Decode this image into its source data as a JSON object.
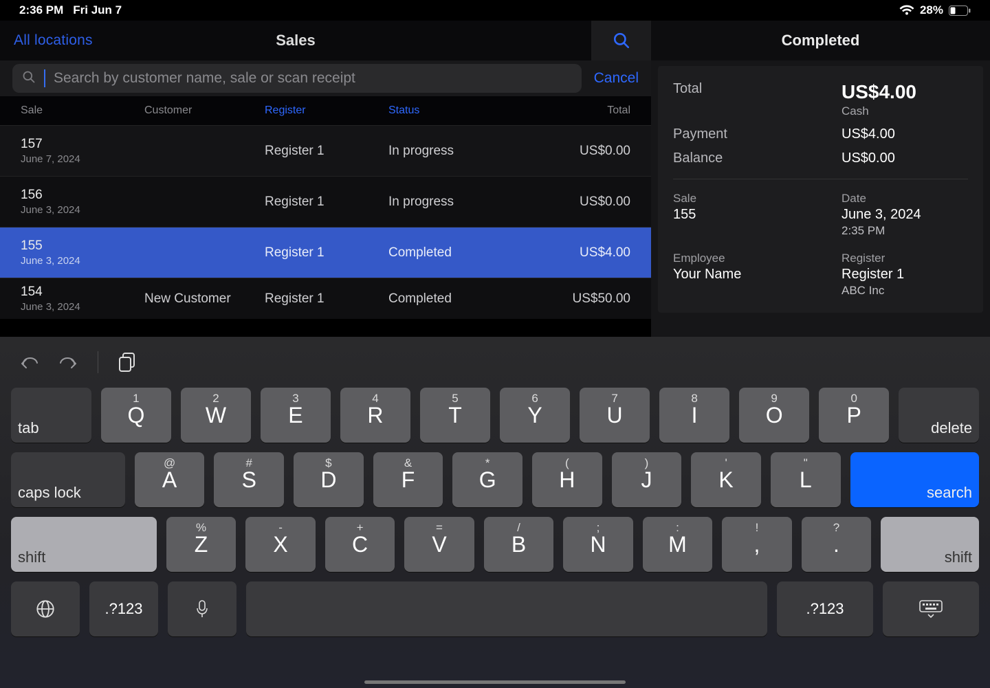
{
  "status": {
    "time": "2:36 PM",
    "date": "Fri Jun 7",
    "battery_pct": "28%"
  },
  "header": {
    "locations": "All locations",
    "title": "Sales"
  },
  "search": {
    "placeholder": "Search by customer name, sale or scan receipt",
    "cancel": "Cancel"
  },
  "columns": {
    "sale": "Sale",
    "customer": "Customer",
    "register": "Register",
    "status": "Status",
    "total": "Total"
  },
  "rows": [
    {
      "id": "157",
      "date": "June 7, 2024",
      "customer": "",
      "register": "Register 1",
      "status": "In progress",
      "total": "US$0.00"
    },
    {
      "id": "156",
      "date": "June 3, 2024",
      "customer": "",
      "register": "Register 1",
      "status": "In progress",
      "total": "US$0.00"
    },
    {
      "id": "155",
      "date": "June 3, 2024",
      "customer": "",
      "register": "Register 1",
      "status": "Completed",
      "total": "US$4.00"
    },
    {
      "id": "154",
      "date": "June 3, 2024",
      "customer": "New Customer",
      "register": "Register 1",
      "status": "Completed",
      "total": "US$50.00"
    }
  ],
  "detail": {
    "header": "Completed",
    "total_label": "Total",
    "total_amount": "US$4.00",
    "total_method": "Cash",
    "payment_label": "Payment",
    "payment_amount": "US$4.00",
    "balance_label": "Balance",
    "balance_amount": "US$0.00",
    "sale_label": "Sale",
    "sale_id": "155",
    "date_label": "Date",
    "date_value": "June 3, 2024",
    "date_time": "2:35 PM",
    "employee_label": "Employee",
    "employee_value": "Your Name",
    "register_label": "Register",
    "register_value": "Register 1",
    "company": "ABC Inc"
  },
  "keyboard": {
    "tab": "tab",
    "delete": "delete",
    "caps": "caps lock",
    "search": "search",
    "shift": "shift",
    "symbols": ".?123",
    "row1_alts": [
      "1",
      "2",
      "3",
      "4",
      "5",
      "6",
      "7",
      "8",
      "9",
      "0"
    ],
    "row1": [
      "Q",
      "W",
      "E",
      "R",
      "T",
      "Y",
      "U",
      "I",
      "O",
      "P"
    ],
    "row2_alts": [
      "@",
      "#",
      "$",
      "&",
      "*",
      "(",
      ")",
      "'",
      "\""
    ],
    "row2": [
      "A",
      "S",
      "D",
      "F",
      "G",
      "H",
      "J",
      "K",
      "L"
    ],
    "row3_alts": [
      "%",
      "-",
      "+",
      "=",
      "/",
      ";",
      ":",
      "!",
      "?"
    ],
    "row3": [
      "Z",
      "X",
      "C",
      "V",
      "B",
      "N",
      "M",
      ",",
      "."
    ]
  }
}
